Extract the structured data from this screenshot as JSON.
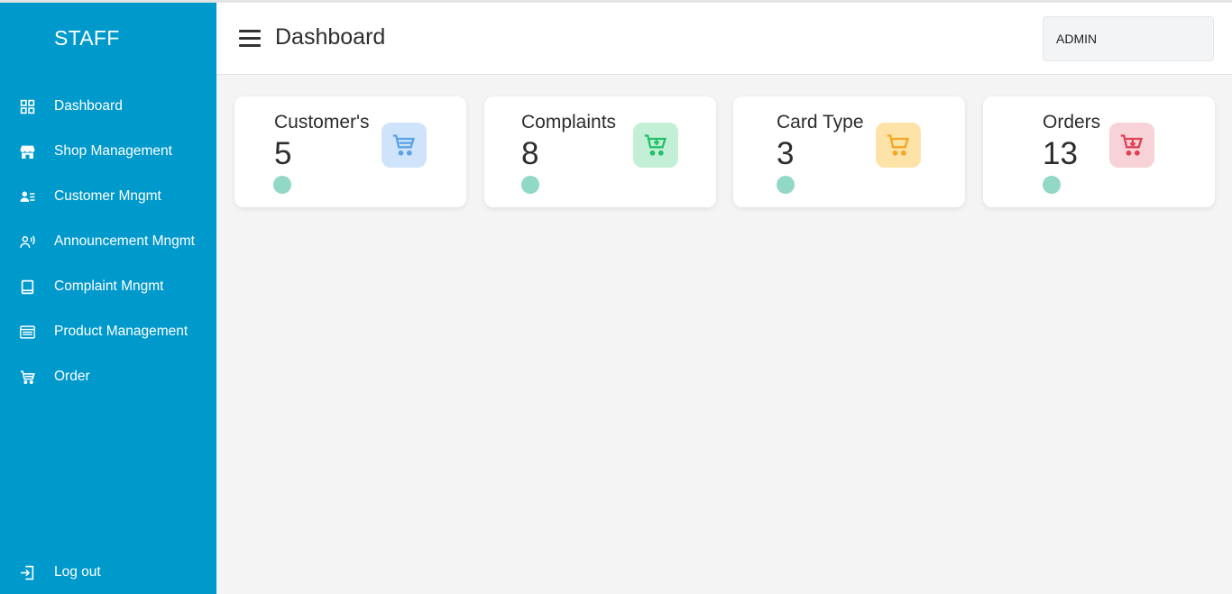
{
  "sidebar": {
    "brand": "STAFF",
    "items": [
      {
        "label": "Dashboard",
        "icon": "grid-icon"
      },
      {
        "label": "Shop Management",
        "icon": "store-icon"
      },
      {
        "label": "Customer Mngmt",
        "icon": "user-list-icon"
      },
      {
        "label": "Announcement Mngmt",
        "icon": "speaker-user-icon"
      },
      {
        "label": "Complaint Mngmt",
        "icon": "book-icon"
      },
      {
        "label": "Product Management",
        "icon": "list-table-icon"
      },
      {
        "label": "Order",
        "icon": "cart-icon"
      }
    ],
    "logout": {
      "label": "Log out",
      "icon": "logout-icon"
    }
  },
  "header": {
    "title": "Dashboard",
    "user": "ADMIN"
  },
  "cards": [
    {
      "label": "Customer's",
      "value": "5",
      "icon": "cart-icon",
      "icon_bg": "#cfe4fa",
      "icon_color": "#5aa2ea"
    },
    {
      "label": "Complaints",
      "value": "8",
      "icon": "cart-plus-icon",
      "icon_bg": "#c3efd6",
      "icon_color": "#22c06b"
    },
    {
      "label": "Card Type",
      "value": "3",
      "icon": "cart-icon",
      "icon_bg": "#fde3a7",
      "icon_color": "#f5a623"
    },
    {
      "label": "Orders",
      "value": "13",
      "icon": "cart-download-icon",
      "icon_bg": "#f7d2d7",
      "icon_color": "#e04155"
    }
  ],
  "colors": {
    "sidebar": "#0099cc",
    "background": "#f4f4f4",
    "status_dot": "#91d8c6"
  }
}
